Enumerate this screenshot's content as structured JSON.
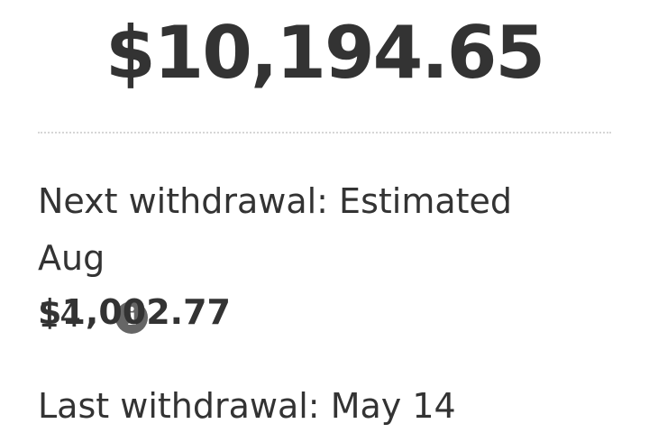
{
  "balance": {
    "amount": "$10,194.65"
  },
  "next_withdrawal": {
    "label_line1": "Next withdrawal: Estimated Aug",
    "label_line2": "14",
    "info_icon": "info-circle-icon",
    "info_glyph": "i",
    "amount": "$1,002.77"
  },
  "last_withdrawal": {
    "label": "Last withdrawal: May 14"
  },
  "colors": {
    "text": "#333333",
    "icon": "#666666",
    "divider": "#d6d6d6"
  }
}
